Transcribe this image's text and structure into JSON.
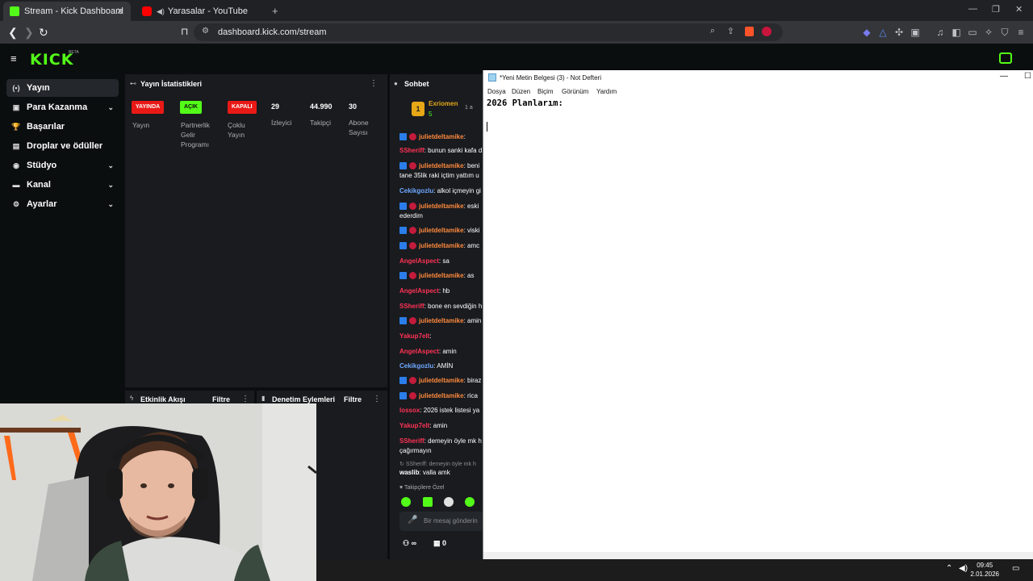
{
  "browser": {
    "tabs": [
      {
        "title": "Stream - Kick Dashboard",
        "active": true
      },
      {
        "title": "Yarasalar - YouTube",
        "active": false
      }
    ],
    "url": "dashboard.kick.com/stream",
    "new_tab": "+"
  },
  "kick": {
    "logo": "KICK",
    "beta": "BETA",
    "sidebar": [
      {
        "label": "Yayın",
        "icon": "broadcast-icon",
        "active": true,
        "expandable": false
      },
      {
        "label": "Para Kazanma",
        "icon": "money-icon",
        "active": false,
        "expandable": true
      },
      {
        "label": "Başarılar",
        "icon": "trophy-icon",
        "active": false,
        "expandable": false
      },
      {
        "label": "Droplar ve ödüller",
        "icon": "gift-icon",
        "active": false,
        "expandable": false
      },
      {
        "label": "Stüdyo",
        "icon": "studio-icon",
        "active": false,
        "expandable": true
      },
      {
        "label": "Kanal",
        "icon": "channel-icon",
        "active": false,
        "expandable": true
      },
      {
        "label": "Ayarlar",
        "icon": "gear-icon",
        "active": false,
        "expandable": true
      }
    ],
    "stats": {
      "title": "Yayın İstatistikleri",
      "live_badge": "YAYINDA",
      "live_label": "Yayın",
      "partner_badge": "AÇIK",
      "partner_label_1": "Partnerlik",
      "partner_label_2": "Gelir",
      "partner_label_3": "Programı",
      "multi_badge": "KAPALI",
      "multi_label_1": "Çoklu",
      "multi_label_2": "Yayın",
      "viewers": "29",
      "viewers_label": "İzleyici",
      "followers": "44.990",
      "followers_label": "Takipçi",
      "subs": "30",
      "subs_label_1": "Abone",
      "subs_label_2": "Sayısı"
    },
    "activity": {
      "title": "Etkinlik Akışı",
      "filter": "Filtre"
    },
    "moderation": {
      "title": "Denetim Eylemleri",
      "filter": "Filtre"
    },
    "chat": {
      "title": "Sohbet",
      "pinned_user": "Exriomen",
      "pinned_count": "5",
      "pinned_side": "1 a",
      "messages": [
        {
          "user": "julietdeltamike",
          "cls": "u-orange",
          "text": ":",
          "badges": true
        },
        {
          "user": "SSheriff",
          "cls": "u-red",
          "text": ": bunun sanki kafa d",
          "badges": false
        },
        {
          "user": "julietdeltamike",
          "cls": "u-orange",
          "text": ": beni",
          "badges": true,
          "cont": "tane 35lik raki içtim yattım u"
        },
        {
          "user": "Cekikgozlu",
          "cls": "u-blue",
          "text": ": alkol içmeyin gi",
          "badges": false
        },
        {
          "user": "julietdeltamike",
          "cls": "u-orange",
          "text": ": eski",
          "badges": true,
          "cont": "ederdim"
        },
        {
          "user": "julietdeltamike",
          "cls": "u-orange",
          "text": ": viski",
          "badges": true
        },
        {
          "user": "julietdeltamike",
          "cls": "u-orange",
          "text": ": amc",
          "badges": true
        },
        {
          "user": "AngelAspect",
          "cls": "u-red",
          "text": ": sa",
          "badges": false
        },
        {
          "user": "julietdeltamike",
          "cls": "u-orange",
          "text": ": as",
          "badges": true
        },
        {
          "user": "AngelAspect",
          "cls": "u-red",
          "text": ": hb",
          "badges": false
        },
        {
          "user": "SSheriff",
          "cls": "u-red",
          "text": ": bone en sevdiğin h",
          "badges": false
        },
        {
          "user": "julietdeltamike",
          "cls": "u-orange",
          "text": ": amin",
          "badges": true
        },
        {
          "user": "Yakup7elt",
          "cls": "u-red",
          "text": ":",
          "badges": false
        },
        {
          "user": "AngelAspect",
          "cls": "u-red",
          "text": ": amin",
          "badges": false
        },
        {
          "user": "Cekikgozlu",
          "cls": "u-blue",
          "text": ": AMİN",
          "badges": false
        },
        {
          "user": "julietdeltamike",
          "cls": "u-orange",
          "text": ": biraz",
          "badges": true
        },
        {
          "user": "julietdeltamike",
          "cls": "u-orange",
          "text": ": rica",
          "badges": true
        },
        {
          "user": "lossox",
          "cls": "u-red",
          "text": ": 2026 istek listesi ya",
          "badges": false
        },
        {
          "user": "Yakup7elt",
          "cls": "u-red",
          "text": ": amin",
          "badges": false
        },
        {
          "user": "SSheriff",
          "cls": "u-red",
          "text": ": demeyin öyle mk h",
          "badges": false,
          "cont": "çağırmayın"
        }
      ],
      "reply_ref": "SSheriff: demeyin öyle mk h",
      "last_user": "waslib",
      "last_text": ": valla amk",
      "followers_only": "Takipçilere Özel",
      "input_placeholder": "Bir mesaj gönderin",
      "viewers_count": "∞",
      "gift_count": "0"
    }
  },
  "notepad": {
    "title": "*Yeni Metin Belgesi (3) - Not Defteri",
    "menu": [
      "Dosya",
      "Düzen",
      "Biçim",
      "Görünüm",
      "Yardım"
    ],
    "content": "2026 Planlarım:"
  },
  "taskbar": {
    "time": "09:45",
    "date": "2.01.2026"
  },
  "colors": {
    "kick_green": "#53fc18",
    "live_red": "#e91916",
    "panel_bg": "#191b1f"
  }
}
